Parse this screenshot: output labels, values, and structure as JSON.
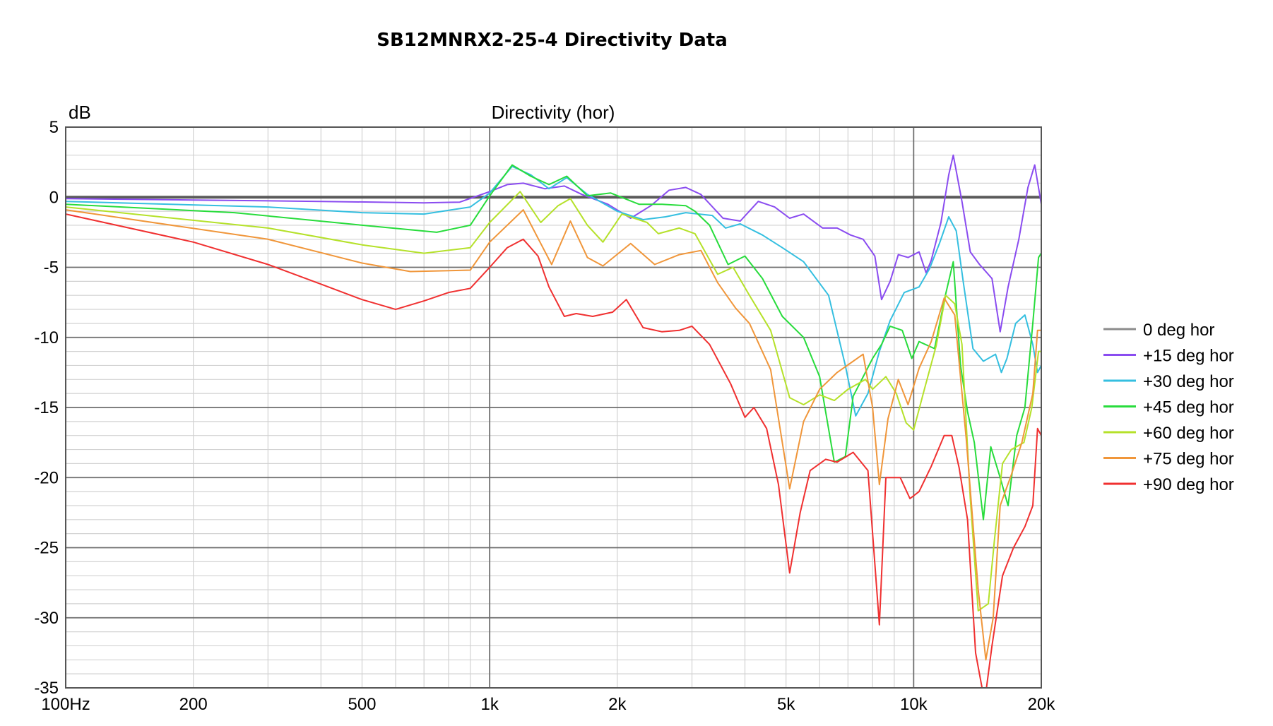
{
  "page_title": "SB12MNRX2-25-4 Directivity Data",
  "chart_data": {
    "type": "line",
    "title": "SB12MNRX2-25-4 Directivity Data",
    "plot_title": "Directivity (hor)",
    "ylabel": "dB",
    "xlabel": "",
    "xscale": "log",
    "xlim": [
      100,
      20000
    ],
    "ylim": [
      -35,
      5
    ],
    "grid": true,
    "legend_position": "right",
    "x_ticks": [
      {
        "value": 100,
        "label": "100Hz"
      },
      {
        "value": 200,
        "label": "200"
      },
      {
        "value": 500,
        "label": "500"
      },
      {
        "value": 1000,
        "label": "1k"
      },
      {
        "value": 2000,
        "label": "2k"
      },
      {
        "value": 5000,
        "label": "5k"
      },
      {
        "value": 10000,
        "label": "10k"
      },
      {
        "value": 20000,
        "label": "20k"
      }
    ],
    "y_ticks": [
      {
        "value": 5,
        "label": "5"
      },
      {
        "value": 0,
        "label": "0"
      },
      {
        "value": -5,
        "label": "-5"
      },
      {
        "value": -10,
        "label": "-10"
      },
      {
        "value": -15,
        "label": "-15"
      },
      {
        "value": -20,
        "label": "-20"
      },
      {
        "value": -25,
        "label": "-25"
      },
      {
        "value": -30,
        "label": "-30"
      },
      {
        "value": -35,
        "label": "-35"
      }
    ],
    "series": [
      {
        "name": "0 deg hor",
        "color": "#8c8c8c",
        "points": [
          [
            100,
            0
          ],
          [
            20000,
            0
          ]
        ]
      },
      {
        "name": "+15 deg hor",
        "color": "#8a4cf0",
        "points": [
          [
            100,
            -0.1
          ],
          [
            200,
            -0.2
          ],
          [
            400,
            -0.3
          ],
          [
            700,
            -0.4
          ],
          [
            850,
            -0.35
          ],
          [
            1000,
            0.4
          ],
          [
            1100,
            0.9
          ],
          [
            1200,
            1.0
          ],
          [
            1350,
            0.6
          ],
          [
            1500,
            0.8
          ],
          [
            1650,
            0.2
          ],
          [
            1900,
            -0.5
          ],
          [
            2150,
            -1.5
          ],
          [
            2400,
            -0.6
          ],
          [
            2650,
            0.5
          ],
          [
            2900,
            0.7
          ],
          [
            3150,
            0.2
          ],
          [
            3550,
            -1.5
          ],
          [
            3900,
            -1.7
          ],
          [
            4300,
            -0.3
          ],
          [
            4700,
            -0.7
          ],
          [
            5100,
            -1.5
          ],
          [
            5500,
            -1.2
          ],
          [
            6100,
            -2.2
          ],
          [
            6600,
            -2.2
          ],
          [
            7100,
            -2.7
          ],
          [
            7600,
            -3.0
          ],
          [
            8100,
            -4.2
          ],
          [
            8400,
            -7.3
          ],
          [
            8800,
            -6.0
          ],
          [
            9200,
            -4.1
          ],
          [
            9700,
            -4.3
          ],
          [
            10300,
            -3.9
          ],
          [
            10700,
            -5.4
          ],
          [
            11000,
            -4.5
          ],
          [
            11600,
            -1.8
          ],
          [
            12100,
            1.6
          ],
          [
            12400,
            3.0
          ],
          [
            13000,
            -0.3
          ],
          [
            13600,
            -3.9
          ],
          [
            14300,
            -4.8
          ],
          [
            15300,
            -5.8
          ],
          [
            16000,
            -9.6
          ],
          [
            16700,
            -6.4
          ],
          [
            17700,
            -3.0
          ],
          [
            18600,
            0.7
          ],
          [
            19300,
            2.3
          ],
          [
            20000,
            -0.5
          ]
        ]
      },
      {
        "name": "+30 deg hor",
        "color": "#35bfe0",
        "points": [
          [
            100,
            -0.3
          ],
          [
            300,
            -0.7
          ],
          [
            500,
            -1.1
          ],
          [
            700,
            -1.2
          ],
          [
            900,
            -0.7
          ],
          [
            1000,
            0.3
          ],
          [
            1130,
            2.2
          ],
          [
            1250,
            1.6
          ],
          [
            1380,
            0.6
          ],
          [
            1520,
            1.4
          ],
          [
            1700,
            0.2
          ],
          [
            2000,
            -1.0
          ],
          [
            2300,
            -1.6
          ],
          [
            2600,
            -1.4
          ],
          [
            2900,
            -1.1
          ],
          [
            3350,
            -1.3
          ],
          [
            3600,
            -2.2
          ],
          [
            3900,
            -1.9
          ],
          [
            4400,
            -2.7
          ],
          [
            4900,
            -3.6
          ],
          [
            5500,
            -4.6
          ],
          [
            6300,
            -7.0
          ],
          [
            6900,
            -12.0
          ],
          [
            7300,
            -15.6
          ],
          [
            7800,
            -14.0
          ],
          [
            8300,
            -11.0
          ],
          [
            8800,
            -8.8
          ],
          [
            9500,
            -6.8
          ],
          [
            10300,
            -6.4
          ],
          [
            10900,
            -5.1
          ],
          [
            11500,
            -3.3
          ],
          [
            12100,
            -1.4
          ],
          [
            12600,
            -2.4
          ],
          [
            13100,
            -6.1
          ],
          [
            13800,
            -10.8
          ],
          [
            14600,
            -11.7
          ],
          [
            15600,
            -11.2
          ],
          [
            16100,
            -12.5
          ],
          [
            16600,
            -11.5
          ],
          [
            17400,
            -9.0
          ],
          [
            18300,
            -8.4
          ],
          [
            19100,
            -10.5
          ],
          [
            19600,
            -12.5
          ],
          [
            20000,
            -12.0
          ]
        ]
      },
      {
        "name": "+45 deg hor",
        "color": "#28dc3c",
        "points": [
          [
            100,
            -0.5
          ],
          [
            250,
            -1.1
          ],
          [
            500,
            -2.0
          ],
          [
            750,
            -2.5
          ],
          [
            900,
            -2.0
          ],
          [
            1000,
            0.1
          ],
          [
            1130,
            2.3
          ],
          [
            1250,
            1.5
          ],
          [
            1380,
            0.9
          ],
          [
            1520,
            1.5
          ],
          [
            1700,
            0.1
          ],
          [
            1930,
            0.3
          ],
          [
            2250,
            -0.5
          ],
          [
            2550,
            -0.5
          ],
          [
            2900,
            -0.6
          ],
          [
            3050,
            -1.0
          ],
          [
            3300,
            -2.0
          ],
          [
            3650,
            -4.8
          ],
          [
            4000,
            -4.2
          ],
          [
            4400,
            -5.8
          ],
          [
            4900,
            -8.5
          ],
          [
            5500,
            -10.0
          ],
          [
            6000,
            -12.8
          ],
          [
            6500,
            -18.9
          ],
          [
            6900,
            -18.5
          ],
          [
            7200,
            -14.2
          ],
          [
            8000,
            -11.5
          ],
          [
            8400,
            -10.5
          ],
          [
            8800,
            -9.2
          ],
          [
            9400,
            -9.5
          ],
          [
            9900,
            -11.5
          ],
          [
            10300,
            -10.3
          ],
          [
            11200,
            -10.8
          ],
          [
            11900,
            -6.9
          ],
          [
            12400,
            -4.6
          ],
          [
            12900,
            -12.0
          ],
          [
            13400,
            -15.3
          ],
          [
            13900,
            -17.5
          ],
          [
            14600,
            -23.0
          ],
          [
            15200,
            -17.8
          ],
          [
            16000,
            -20.0
          ],
          [
            16700,
            -22.0
          ],
          [
            17500,
            -17.0
          ],
          [
            18300,
            -15.0
          ],
          [
            19100,
            -9.0
          ],
          [
            19700,
            -4.3
          ],
          [
            20000,
            -4.0
          ]
        ]
      },
      {
        "name": "+60 deg hor",
        "color": "#b5e12a",
        "points": [
          [
            100,
            -0.7
          ],
          [
            300,
            -2.2
          ],
          [
            500,
            -3.4
          ],
          [
            700,
            -4.0
          ],
          [
            900,
            -3.6
          ],
          [
            1000,
            -1.8
          ],
          [
            1180,
            0.4
          ],
          [
            1320,
            -1.8
          ],
          [
            1450,
            -0.6
          ],
          [
            1550,
            -0.1
          ],
          [
            1700,
            -2.0
          ],
          [
            1850,
            -3.2
          ],
          [
            2050,
            -1.2
          ],
          [
            2350,
            -1.8
          ],
          [
            2500,
            -2.6
          ],
          [
            2800,
            -2.2
          ],
          [
            3050,
            -2.6
          ],
          [
            3450,
            -5.5
          ],
          [
            3750,
            -5.0
          ],
          [
            4100,
            -7.0
          ],
          [
            4600,
            -9.5
          ],
          [
            5100,
            -14.3
          ],
          [
            5500,
            -14.8
          ],
          [
            6000,
            -14.1
          ],
          [
            6500,
            -14.5
          ],
          [
            7000,
            -13.7
          ],
          [
            7700,
            -13.0
          ],
          [
            8000,
            -13.7
          ],
          [
            8600,
            -12.8
          ],
          [
            9100,
            -14.0
          ],
          [
            9600,
            -16.1
          ],
          [
            10000,
            -16.6
          ],
          [
            10600,
            -13.7
          ],
          [
            11300,
            -10.6
          ],
          [
            11900,
            -7.0
          ],
          [
            12500,
            -7.6
          ],
          [
            13000,
            -10.5
          ],
          [
            13600,
            -21.5
          ],
          [
            14200,
            -29.5
          ],
          [
            15000,
            -29.0
          ],
          [
            15500,
            -24.5
          ],
          [
            16200,
            -19.0
          ],
          [
            17000,
            -18.0
          ],
          [
            18200,
            -17.5
          ],
          [
            19000,
            -15.0
          ],
          [
            19700,
            -11.0
          ],
          [
            20000,
            -11.0
          ]
        ]
      },
      {
        "name": "+75 deg hor",
        "color": "#f0963a",
        "points": [
          [
            100,
            -0.9
          ],
          [
            300,
            -3.0
          ],
          [
            500,
            -4.7
          ],
          [
            650,
            -5.3
          ],
          [
            900,
            -5.2
          ],
          [
            1000,
            -3.2
          ],
          [
            1200,
            -0.9
          ],
          [
            1400,
            -4.8
          ],
          [
            1550,
            -1.7
          ],
          [
            1700,
            -4.3
          ],
          [
            1850,
            -4.9
          ],
          [
            2150,
            -3.3
          ],
          [
            2450,
            -4.8
          ],
          [
            2800,
            -4.1
          ],
          [
            3150,
            -3.8
          ],
          [
            3450,
            -6.1
          ],
          [
            3800,
            -7.9
          ],
          [
            4100,
            -9.0
          ],
          [
            4600,
            -12.3
          ],
          [
            4900,
            -17.5
          ],
          [
            5100,
            -20.8
          ],
          [
            5500,
            -16.0
          ],
          [
            6000,
            -13.7
          ],
          [
            6600,
            -12.5
          ],
          [
            7200,
            -11.7
          ],
          [
            7600,
            -11.2
          ],
          [
            8000,
            -15.0
          ],
          [
            8300,
            -20.5
          ],
          [
            8700,
            -15.8
          ],
          [
            9200,
            -13.0
          ],
          [
            9700,
            -14.8
          ],
          [
            10300,
            -12.2
          ],
          [
            11000,
            -10.3
          ],
          [
            11800,
            -7.2
          ],
          [
            12500,
            -8.4
          ],
          [
            13300,
            -17.2
          ],
          [
            14200,
            -28.0
          ],
          [
            14800,
            -33.0
          ],
          [
            15400,
            -30.0
          ],
          [
            16000,
            -22.0
          ],
          [
            17000,
            -19.8
          ],
          [
            18000,
            -17.5
          ],
          [
            19100,
            -14.0
          ],
          [
            19600,
            -9.5
          ],
          [
            20000,
            -9.5
          ]
        ]
      },
      {
        "name": "+90 deg hor",
        "color": "#f03030",
        "points": [
          [
            100,
            -1.2
          ],
          [
            200,
            -3.2
          ],
          [
            300,
            -4.8
          ],
          [
            400,
            -6.2
          ],
          [
            500,
            -7.3
          ],
          [
            600,
            -8.0
          ],
          [
            700,
            -7.4
          ],
          [
            800,
            -6.8
          ],
          [
            900,
            -6.5
          ],
          [
            1000,
            -5.0
          ],
          [
            1100,
            -3.6
          ],
          [
            1200,
            -3.0
          ],
          [
            1300,
            -4.2
          ],
          [
            1380,
            -6.4
          ],
          [
            1500,
            -8.5
          ],
          [
            1600,
            -8.3
          ],
          [
            1750,
            -8.5
          ],
          [
            1950,
            -8.2
          ],
          [
            2100,
            -7.3
          ],
          [
            2300,
            -9.3
          ],
          [
            2550,
            -9.6
          ],
          [
            2800,
            -9.5
          ],
          [
            3000,
            -9.2
          ],
          [
            3300,
            -10.5
          ],
          [
            3700,
            -13.3
          ],
          [
            4000,
            -15.7
          ],
          [
            4200,
            -15.0
          ],
          [
            4500,
            -16.5
          ],
          [
            4800,
            -20.5
          ],
          [
            5100,
            -26.8
          ],
          [
            5400,
            -22.5
          ],
          [
            5700,
            -19.5
          ],
          [
            6200,
            -18.7
          ],
          [
            6600,
            -18.9
          ],
          [
            7200,
            -18.2
          ],
          [
            7800,
            -19.5
          ],
          [
            8300,
            -30.5
          ],
          [
            8600,
            -20.0
          ],
          [
            9300,
            -20.0
          ],
          [
            9800,
            -21.5
          ],
          [
            10300,
            -21.0
          ],
          [
            11000,
            -19.2
          ],
          [
            11800,
            -17.0
          ],
          [
            12300,
            -17.0
          ],
          [
            12800,
            -19.3
          ],
          [
            13400,
            -23.0
          ],
          [
            14000,
            -32.5
          ],
          [
            14700,
            -36.0
          ],
          [
            15300,
            -32.0
          ],
          [
            16200,
            -27.0
          ],
          [
            17200,
            -25.0
          ],
          [
            18300,
            -23.5
          ],
          [
            19100,
            -22.0
          ],
          [
            19600,
            -16.5
          ],
          [
            20000,
            -17.0
          ]
        ]
      }
    ]
  }
}
